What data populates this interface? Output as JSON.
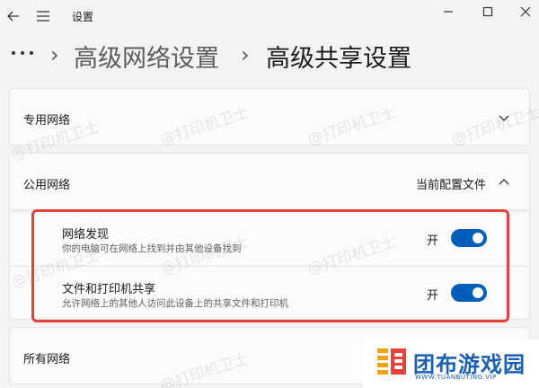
{
  "window": {
    "title": "设置"
  },
  "breadcrumb": {
    "items": [
      "高级网络设置",
      "高级共享设置"
    ]
  },
  "sections": {
    "private": {
      "label": "专用网络"
    },
    "public": {
      "label": "公用网络",
      "status": "当前配置文件",
      "rows": [
        {
          "title": "网络发现",
          "description": "你的电脑可在网络上找到并由其他设备找到",
          "state": "开",
          "on": true
        },
        {
          "title": "文件和打印机共享",
          "description": "允许网络上的其他人访问此设备上的共享文件和打印机",
          "state": "开",
          "on": true
        }
      ]
    },
    "all": {
      "label": "所有网络"
    }
  },
  "watermark": "@打印机卫士",
  "logo": {
    "name": "团布游戏园",
    "url": "WWW.TUANBUTING.VIP"
  },
  "colors": {
    "accent": "#005fb8",
    "highlight": "#e8413a",
    "logo": "#1a5fb4"
  }
}
